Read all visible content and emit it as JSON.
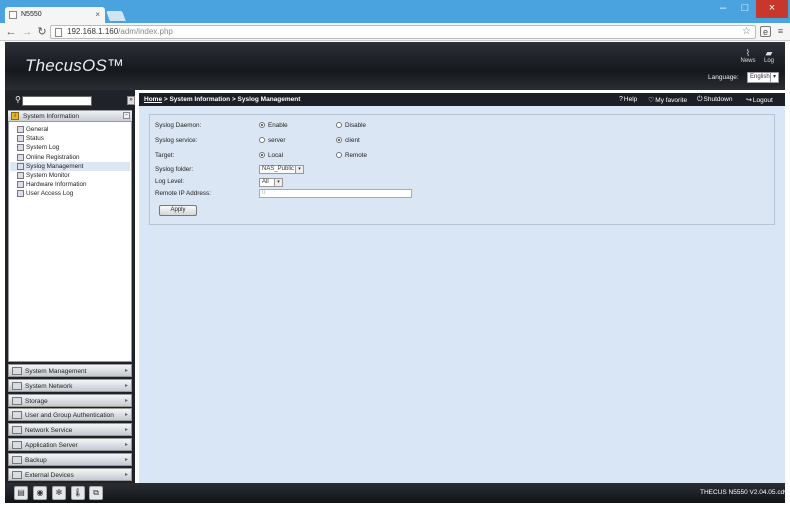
{
  "browser": {
    "tab_title": "N5550",
    "tab_close": "×",
    "url_host": "192.168.1.160",
    "url_path": "/adm/index.php",
    "window_min": "–",
    "window_max": "□",
    "window_close": "×"
  },
  "header": {
    "logo": "ThecusOS™",
    "news_label": "News",
    "log_label": "Log",
    "language_label": "Language:",
    "language_value": "English"
  },
  "breadcrumb": {
    "home": "Home",
    "rest": " > System Information > Syslog Management"
  },
  "topbar": {
    "help": "Help",
    "favorite": "My favorite",
    "shutdown": "Shutdown",
    "logout": "Logout"
  },
  "sidebar": {
    "section": "System Information",
    "items": [
      "General",
      "Status",
      "System Log",
      "Online Registration",
      "Syslog Management",
      "System Monitor",
      "Hardware Information",
      "User Access Log"
    ],
    "selected_index": 4,
    "groups": [
      "System Management",
      "System Network",
      "Storage",
      "User and Group Authentication",
      "Network Service",
      "Application Server",
      "Backup",
      "External Devices"
    ]
  },
  "form": {
    "daemon_label": "Syslog Daemon:",
    "daemon_enable": "Enable",
    "daemon_disable": "Disable",
    "service_label": "Syslog service:",
    "service_server": "server",
    "service_client": "client",
    "target_label": "Target:",
    "target_local": "Local",
    "target_remote": "Remote",
    "folder_label": "Syslog folder:",
    "folder_value": "NAS_Public",
    "level_label": "Log Level:",
    "level_value": "All",
    "ip_label": "Remote IP Address:",
    "ip_value": "0",
    "apply_label": "Apply"
  },
  "footer": {
    "version": "THECUS N5550 V2.04.05.cdv"
  }
}
